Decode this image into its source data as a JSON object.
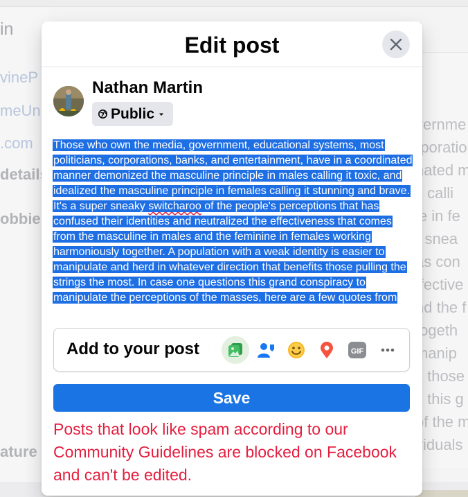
{
  "background": {
    "left_texts": [
      "in",
      "vineP",
      "meUni",
      ".com",
      "details",
      "obbie",
      "ature"
    ],
    "right_texts": [
      "vernme",
      "rporatio",
      "nated m",
      "s calli",
      "le in fe",
      "r snea",
      "as con",
      "ffective",
      "nd the f",
      "togeth",
      "manip",
      "s those",
      "s this g",
      "of the m",
      "viduals"
    ]
  },
  "modal": {
    "title": "Edit post",
    "close_icon": "close-icon",
    "author": {
      "name": "Nathan Martin",
      "audience": "Public",
      "audience_icon": "globe-icon",
      "dropdown_icon": "caret-down-icon"
    },
    "post_text": {
      "before_misspelling": "Those who own the media, government, educational systems, most politicians, corporations, banks, and entertainment, have in a coordinated manner demonized the masculine principle in males calling it toxic, and idealized the masculine principle in females calling it stunning and brave. It's a super sneaky ",
      "misspelled_word": "switcharoo",
      "after_misspelling": " of the people's perceptions that has confused their identities and neutralized the effectiveness that comes from the masculine in males and the feminine in females working harmoniously together. A population with a weak identity is easier to manipulate and herd in whatever direction that benefits those pulling the strings the most. In case one questions this grand conspiracy to manipulate the perceptions of the masses, here are a few quotes from"
    },
    "add_to_post": {
      "label": "Add to your post",
      "icons": [
        {
          "name": "photo-video-icon",
          "color": "#45bd62",
          "active": true
        },
        {
          "name": "tag-people-icon",
          "color": "#1877f2"
        },
        {
          "name": "feeling-activity-icon",
          "color": "#f7b928"
        },
        {
          "name": "check-in-icon",
          "color": "#f5533d"
        },
        {
          "name": "gif-icon",
          "color": "#8a8d91",
          "text": "GIF"
        },
        {
          "name": "more-icon",
          "color": "#65676b"
        }
      ]
    },
    "save_label": "Save",
    "warning": "Posts that look like spam according to our Community Guidelines are blocked on Facebook and can't be edited."
  },
  "colors": {
    "accent": "#1b74e4",
    "selection": "#1f6fe4",
    "warning": "#e41e3f"
  }
}
